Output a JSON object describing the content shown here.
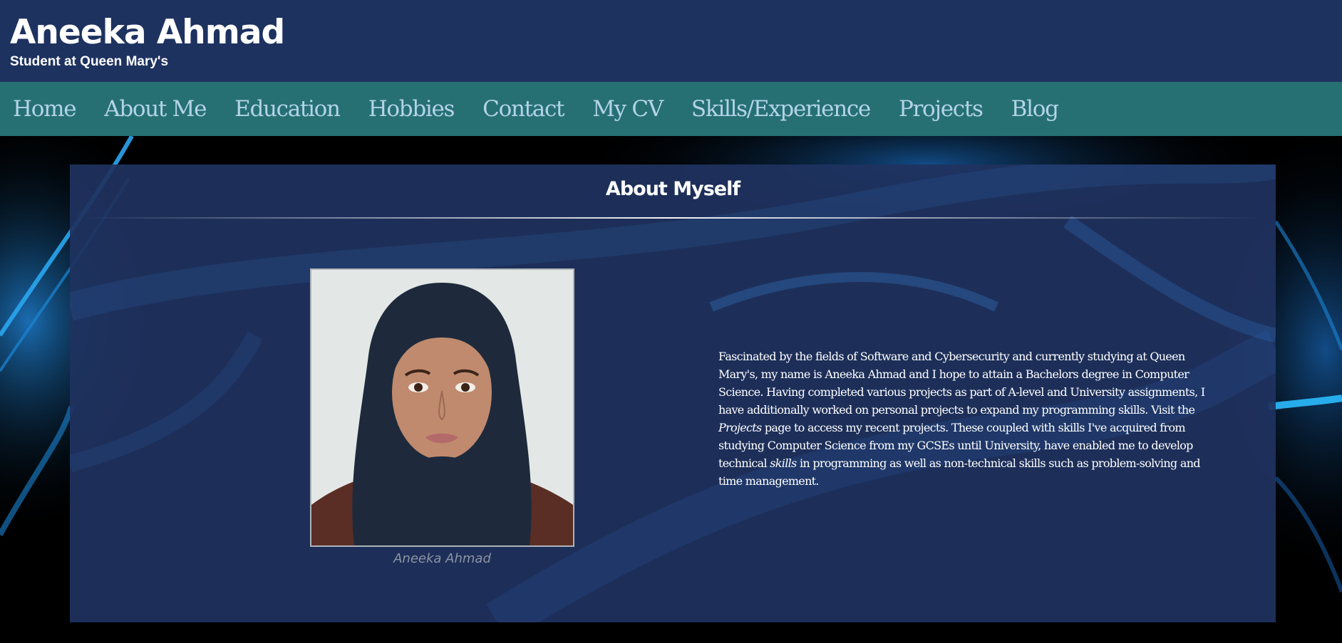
{
  "header": {
    "title": "Aneeka Ahmad",
    "subtitle": "Student at Queen Mary's"
  },
  "nav": {
    "items": [
      "Home",
      "About Me",
      "Education",
      "Hobbies",
      "Contact",
      "My CV",
      "Skills/Experience",
      "Projects",
      "Blog"
    ]
  },
  "about": {
    "heading": "About Myself",
    "photo_caption": "Aneeka Ahmad",
    "bio": {
      "part1": "Fascinated by the fields of Software and Cybersecurity and currently studying at Queen Mary's, my name is Aneeka Ahmad and I hope to attain a Bachelors degree in Computer Science. Having completed various projects as part of A-level and University assignments, I have additionally worked on personal projects to expand my programming skills. Visit the ",
      "projects_link": "Projects",
      "part2": " page to access my recent projects. These coupled with skills I've acquired from studying Computer Science from my GCSEs until University, have enabled me to develop technical ",
      "skills_word": "skills",
      "part3": " in programming as well as non-technical skills such as problem-solving and time management."
    }
  },
  "colors": {
    "header_bg": "#1e3260",
    "nav_bg": "#267074",
    "nav_text": "#b4d3e8",
    "card_bg": "#1f3360",
    "accent_blue": "#1a8ad8"
  }
}
